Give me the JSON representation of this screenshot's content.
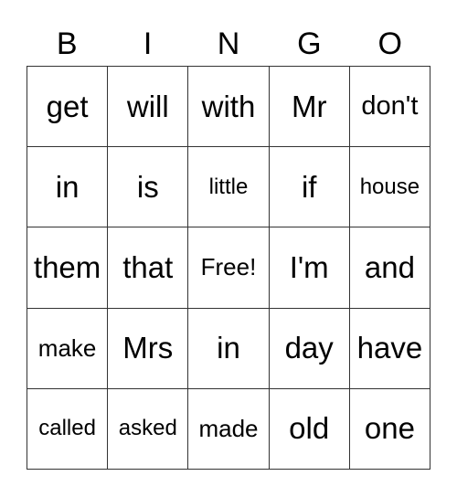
{
  "header": [
    "B",
    "I",
    "N",
    "G",
    "O"
  ],
  "cells": [
    [
      "get",
      "will",
      "with",
      "Mr",
      "don't"
    ],
    [
      "in",
      "is",
      "little",
      "if",
      "house"
    ],
    [
      "them",
      "that",
      "Free!",
      "I'm",
      "and"
    ],
    [
      "make",
      "Mrs",
      "in",
      "day",
      "have"
    ],
    [
      "called",
      "asked",
      "made",
      "old",
      "one"
    ]
  ]
}
